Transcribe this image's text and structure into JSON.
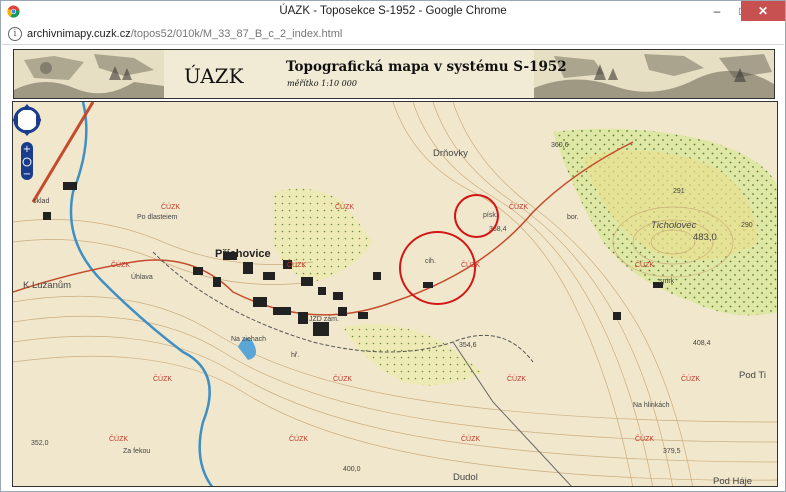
{
  "window": {
    "title": "ÚAZK - Toposekce S-1952 - Google Chrome",
    "controls": [
      "–",
      "□",
      "✕"
    ]
  },
  "address_bar": {
    "url_host": "archivnimapy.cuzk.cz",
    "url_path": "/topos52/010k/M_33_87_B_c_2_index.html"
  },
  "banner": {
    "brand": "ÚAZK",
    "title": "Topografická mapa v systému S-1952",
    "scale": "měřítko 1:10 000"
  },
  "map": {
    "places": [
      {
        "name": "Příchovice",
        "kind": "place"
      },
      {
        "name": "Drňovky",
        "kind": "area"
      },
      {
        "name": "Ticholovec",
        "kind": "area"
      },
      {
        "name": "K Lužanům",
        "kind": "area"
      },
      {
        "name": "Dudol",
        "kind": "area"
      },
      {
        "name": "Pod Háje",
        "kind": "area"
      },
      {
        "name": "Pod Ti",
        "kind": "area"
      },
      {
        "name": "Na hlinkách",
        "kind": "small"
      },
      {
        "name": "Za fekou",
        "kind": "small"
      },
      {
        "name": "Po dlasteiem",
        "kind": "small"
      },
      {
        "name": "Úhlava",
        "kind": "small"
      },
      {
        "name": "sklad",
        "kind": "small"
      },
      {
        "name": "JZD zám.",
        "kind": "small"
      },
      {
        "name": "hř.",
        "kind": "small"
      },
      {
        "name": "cih.",
        "kind": "small"
      },
      {
        "name": "písk.",
        "kind": "small"
      },
      {
        "name": "bor.",
        "kind": "small"
      },
      {
        "name": "smrk",
        "kind": "small"
      },
      {
        "name": "Na ziehach",
        "kind": "small"
      }
    ],
    "elevations": [
      "291",
      "290",
      "483,0",
      "408,4",
      "360,6",
      "352,0",
      "379,5",
      "400,0",
      "368,4",
      "354,6"
    ],
    "watermark": "ČÚZK",
    "navigation": {
      "zoom_in": "+",
      "zoom_out": "−"
    },
    "highlight_rings": 2
  }
}
